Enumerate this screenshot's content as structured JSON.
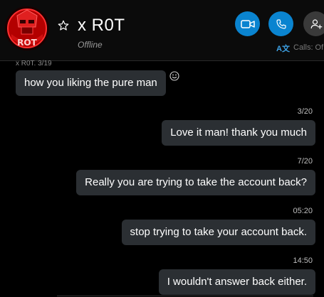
{
  "header": {
    "name": "x R0T",
    "status": "Offline",
    "calls_label": "Calls: Of",
    "translate_label": "A文"
  },
  "colors": {
    "accent": "#0a84d0",
    "bubble": "#2b2f33",
    "background": "#000000"
  },
  "icons": {
    "avatar": "red-robot-avatar",
    "favorite": "star-icon",
    "video": "video-call-icon",
    "call": "phone-icon",
    "add_person": "add-person-icon",
    "react": "emoji-icon",
    "translate": "translate-icon"
  },
  "messages": [
    {
      "direction": "incoming",
      "sender_partial": "x R0T, 3/19",
      "text": "how you liking the pure man"
    },
    {
      "direction": "outgoing",
      "time": "3/20",
      "text": "Love it man! thank you much"
    },
    {
      "direction": "outgoing",
      "time": "7/20",
      "text": "Really you are trying to take the account back?"
    },
    {
      "direction": "outgoing",
      "time": "05:20",
      "text": "stop trying to take your account back."
    },
    {
      "direction": "outgoing",
      "time": "14:50",
      "text": "I wouldn't answer back either."
    }
  ]
}
